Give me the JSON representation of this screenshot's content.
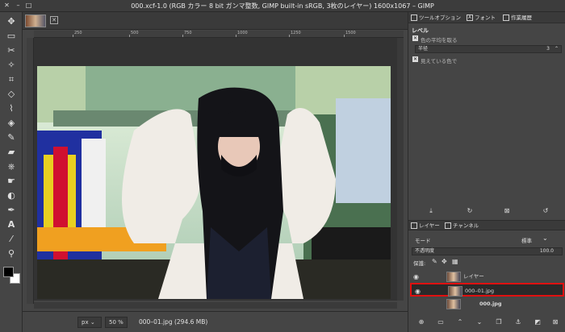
{
  "window": {
    "title": "000.xcf-1.0 (RGB カラー 8 bit ガンマ整数, GIMP built-in sRGB, 3枚のレイヤー) 1600x1067 – GIMP"
  },
  "rulers": {
    "top_labels": [
      "250",
      "500",
      "750",
      "1000",
      "1250",
      "1500"
    ]
  },
  "status": {
    "unit": "px",
    "zoom": "50 %",
    "layer_info": "000–01.jpg (294.6 MB)"
  },
  "dock": {
    "tabs": [
      "ツールオプション",
      "フォント",
      "作業履歴"
    ],
    "levels_title": "レベル",
    "sample_average_label": "色の平均を取る",
    "radius_label": "半径",
    "radius_value": "3",
    "sample_merged_label": "見えている色で",
    "layer_tabs": [
      "レイヤー",
      "チャンネル"
    ],
    "mode_label": "モード",
    "mode_value": "標準",
    "opacity_label": "不透明度",
    "opacity_value": "100.0",
    "lock_label": "保護:"
  },
  "layers": [
    {
      "name": "レイヤー",
      "visible": true,
      "selected": false
    },
    {
      "name": "000–01.jpg",
      "visible": true,
      "selected": true
    },
    {
      "name": "000.jpg",
      "visible": false,
      "selected": false
    }
  ],
  "colors": {
    "selection_highlight": "#e01010",
    "foreground": "#000000",
    "background": "#ffffff"
  }
}
